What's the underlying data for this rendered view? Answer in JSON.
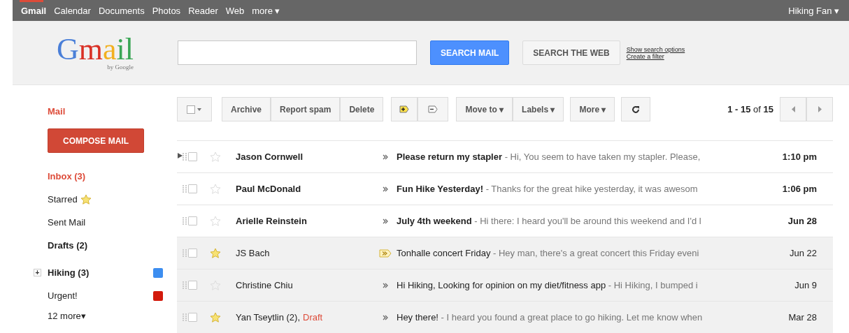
{
  "top_bar": {
    "links": [
      {
        "label": "Gmail",
        "selected": true
      },
      {
        "label": "Calendar",
        "selected": false
      },
      {
        "label": "Documents",
        "selected": false
      },
      {
        "label": "Photos",
        "selected": false
      },
      {
        "label": "Reader",
        "selected": false
      },
      {
        "label": "Web",
        "selected": false
      },
      {
        "label": "more ▾",
        "selected": false
      }
    ],
    "account": "Hiking Fan ▾"
  },
  "header": {
    "logo": "Gmail",
    "logo_sub": "by Google",
    "search_mail": "SEARCH MAIL",
    "search_web": "SEARCH THE WEB",
    "links": [
      "Show search options",
      "Create a filter"
    ]
  },
  "sidebar": {
    "title": "Mail",
    "compose": "COMPOSE MAIL",
    "items": [
      {
        "label": "Inbox (3)",
        "selected": true,
        "bold": true
      },
      {
        "label": "Starred",
        "selected": false,
        "bold": false,
        "kind": "starred"
      },
      {
        "label": "Sent Mail",
        "selected": false,
        "bold": false
      },
      {
        "label": "Drafts (2)",
        "selected": false,
        "bold": true
      }
    ],
    "labels": [
      {
        "label": "Hiking (3)",
        "bold": true,
        "expander": "+",
        "color": "#3d8ef0"
      },
      {
        "label": "Urgent!",
        "bold": false,
        "color": "#d31a0c"
      }
    ],
    "more": "12 more▾"
  },
  "toolbar": {
    "archive": "Archive",
    "report_spam": "Report spam",
    "delete": "Delete",
    "move_to": "Move to ▾",
    "labels": "Labels ▾",
    "more": "More ▾",
    "range": "**1 - 15** of **15**"
  },
  "messages": [
    {
      "sender": "Jason Cornwell",
      "unread": true,
      "starred": false,
      "focused": true,
      "important": false,
      "subject": "Please return my stapler",
      "snippet": " - Hi, You seem to have taken my stapler. Please,",
      "date": "1:10 pm"
    },
    {
      "sender": "Paul McDonald",
      "unread": true,
      "starred": false,
      "focused": false,
      "important": false,
      "subject": "Fun Hike Yesterday!",
      "snippet": " - Thanks for the great hike yesterday, it was awesom",
      "date": "1:06 pm"
    },
    {
      "sender": "Arielle Reinstein",
      "unread": true,
      "starred": false,
      "focused": false,
      "important": false,
      "subject": "July 4th weekend",
      "snippet": " - Hi there: I heard you'll be around this weekend and I'd l",
      "date": "Jun 28"
    },
    {
      "sender": "JS Bach",
      "unread": false,
      "starred": true,
      "focused": false,
      "important": true,
      "subject": "Tonhalle concert Friday",
      "snippet": " - Hey man, there's a great concert this Friday eveni",
      "date": "Jun 22"
    },
    {
      "sender": "Christine Chiu",
      "unread": false,
      "starred": false,
      "focused": false,
      "important": false,
      "subject": "Hi Hiking, Looking for opinion on my diet/fitness app",
      "snippet": " - Hi Hiking, I bumped i",
      "date": "Jun 9"
    },
    {
      "sender": "Yan Tseytlin (2),",
      "draft": "Draft",
      "unread": false,
      "starred": true,
      "focused": false,
      "important": false,
      "subject": "Hey there!",
      "snippet": " - I heard you found a great place to go hiking. Let me know when",
      "date": "Mar 28"
    }
  ]
}
